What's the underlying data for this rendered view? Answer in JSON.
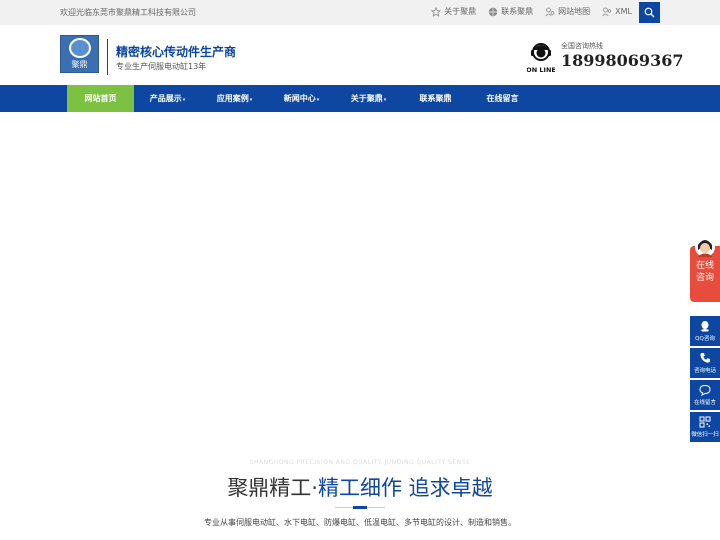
{
  "topbar": {
    "welcome": "欢迎光临东莞市聚鼎精工科技有限公司",
    "links": [
      {
        "label": "关于聚鼎",
        "icon": "star-icon"
      },
      {
        "label": "联系聚鼎",
        "icon": "globe-icon"
      },
      {
        "label": "网站地图",
        "icon": "sitemap-icon"
      },
      {
        "label": "XML",
        "icon": "rss-icon"
      }
    ],
    "search_icon": "search-icon"
  },
  "header": {
    "logo_text": "聚鼎",
    "slogan_main": "精密核心传动件生产商",
    "slogan_sub": "专业生产伺服电动缸13年",
    "hotline_label": "全国咨询热线",
    "hotline_number": "18998069367",
    "online_badge": "ON LINE"
  },
  "nav": {
    "items": [
      {
        "label": "网站首页",
        "active": true,
        "caret": false
      },
      {
        "label": "产品展示",
        "active": false,
        "caret": true
      },
      {
        "label": "应用案例",
        "active": false,
        "caret": true
      },
      {
        "label": "新闻中心",
        "active": false,
        "caret": true
      },
      {
        "label": "关于聚鼎",
        "active": false,
        "caret": true
      },
      {
        "label": "联系聚鼎",
        "active": false,
        "caret": false
      },
      {
        "label": "在线留言",
        "active": false,
        "caret": false
      }
    ],
    "caret_glyph": "▾"
  },
  "section": {
    "en_title": "SHANGHONG PRECISION AND QUALITY  JUNDING QUALITY SENSE",
    "title_part1": "聚鼎精工·",
    "title_part2": "精工细作 追求卓越",
    "description": "专业从事伺服电动缸、水下电缸、防爆电缸、低温电缸、多节电缸的设计、制造和销售。"
  },
  "sidebar": {
    "consult_line1": "在线",
    "consult_line2": "咨询",
    "tools": [
      {
        "label": "QQ咨询",
        "icon": "qq-icon"
      },
      {
        "label": "咨询电话",
        "icon": "phone-icon"
      },
      {
        "label": "在线留言",
        "icon": "message-icon"
      },
      {
        "label": "微信扫一扫",
        "icon": "qrcode-icon"
      }
    ]
  },
  "colors": {
    "brand_blue": "#0d47a1",
    "active_green": "#7cc142",
    "consult_red": "#e74c3c"
  }
}
